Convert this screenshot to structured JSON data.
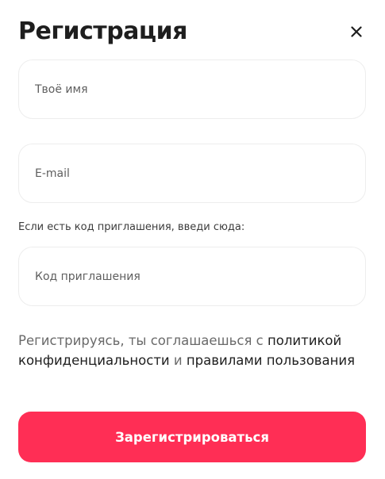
{
  "modal": {
    "title": "Регистрация",
    "close_icon": "close-icon"
  },
  "form": {
    "name": {
      "placeholder": "Твоё имя",
      "value": ""
    },
    "email": {
      "placeholder": "E-mail",
      "value": ""
    },
    "invite_hint": "Если есть код приглашения, введи сюда:",
    "invite_code": {
      "placeholder": "Код приглашения",
      "value": ""
    }
  },
  "agreement": {
    "prefix": "Регистрируясь, ты соглашаешься с ",
    "privacy_link": "политикой конфиденциальности",
    "conjunction": " и ",
    "terms_link": "правилами пользования"
  },
  "submit": {
    "label": "Зарегистрироваться"
  },
  "colors": {
    "accent": "#ff2e55",
    "text_dark": "#1e1e1e",
    "text_muted": "#6a6a6a",
    "border": "#ededed"
  }
}
